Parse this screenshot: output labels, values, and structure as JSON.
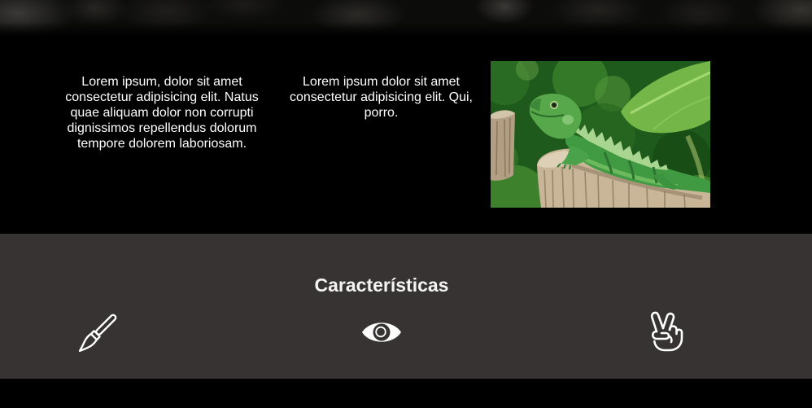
{
  "info": {
    "columns": [
      {
        "text": "Lorem ipsum, dolor sit amet consectetur adipisicing elit. Natus quae aliquam dolor non corrupti dignissimos repellendus dolorum tempore dolorem laboriosam."
      },
      {
        "text": "Lorem ipsum dolor sit amet consectetur adipisicing elit. Qui, porro."
      }
    ]
  },
  "features": {
    "title": "Características",
    "icons": [
      {
        "icon": "paintbrush-icon"
      },
      {
        "icon": "eye-icon"
      },
      {
        "icon": "peace-hand-icon"
      }
    ]
  },
  "colors": {
    "page_background": "#000000",
    "features_background": "#373333",
    "text": "#ffffff"
  }
}
